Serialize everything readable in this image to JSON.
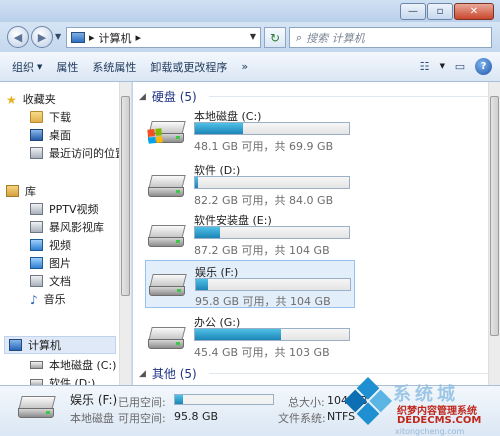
{
  "window": {
    "buttons": [
      "—",
      "▫",
      "✕"
    ]
  },
  "addressbar": {
    "path_root": "▸",
    "path_item": "计算机",
    "path_sep": "▸",
    "search_placeholder": "搜索 计算机"
  },
  "toolbar": {
    "items": [
      "组织",
      "属性",
      "系统属性",
      "卸载或更改程序",
      "»"
    ]
  },
  "nav": {
    "favorites": "收藏夹",
    "favorites_items": [
      "下载",
      "桌面",
      "最近访问的位置"
    ],
    "libraries": "库",
    "library_items": [
      "PPTV视频",
      "暴风影视库",
      "视频",
      "图片",
      "文档",
      "音乐"
    ],
    "computer": "计算机",
    "computer_items": [
      "本地磁盘 (C:)",
      "软件 (D:)"
    ]
  },
  "groups": {
    "hdd": "硬盘 (5)",
    "other": "其他 (5)"
  },
  "drives": [
    {
      "name": "本地磁盘 (C:)",
      "info": "48.1 GB 可用，共 69.9 GB",
      "used_fraction": 0.31
    },
    {
      "name": "软件 (D:)",
      "info": "82.2 GB 可用，共 84.0 GB",
      "used_fraction": 0.02
    },
    {
      "name": "软件安装盘 (E:)",
      "info": "87.2 GB 可用，共 104 GB",
      "used_fraction": 0.16
    },
    {
      "name": "娱乐 (F:)",
      "info": "95.8 GB 可用，共 104 GB",
      "used_fraction": 0.08
    },
    {
      "name": "办公 (G:)",
      "info": "45.4 GB 可用，共 103 GB",
      "used_fraction": 0.56
    }
  ],
  "details": {
    "name": "娱乐 (F:)",
    "used_label": "已用空间:",
    "type": "本地磁盘",
    "free_label": "可用空间:",
    "free_value": "95.8 GB",
    "total_label": "总大小:",
    "total_value": "104 GB",
    "fs_label": "文件系统:",
    "fs_value": "NTFS",
    "used_fraction": 0.08
  },
  "watermark": {
    "big": "系统城",
    "line1": "织梦内容管理系统",
    "line2": "DEDECMS.COM",
    "line3": "xitongcheng.com"
  }
}
